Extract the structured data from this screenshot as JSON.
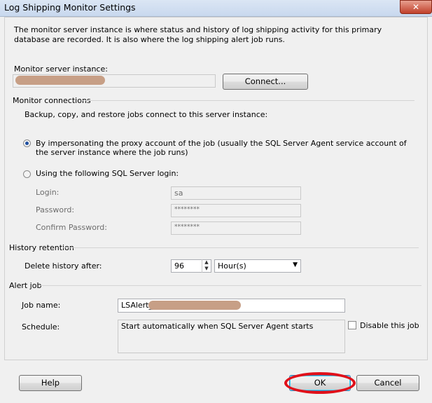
{
  "window": {
    "title": "Log Shipping Monitor Settings",
    "close_label": "✕"
  },
  "description": "The monitor server instance is where status and history of log shipping activity for this primary database are recorded. It is also where the log shipping alert job runs.",
  "monitor_server": {
    "label": "Monitor server instance:",
    "value": "",
    "connect_label": "Connect..."
  },
  "connections": {
    "header": "Monitor connections",
    "intro": "Backup, copy, and restore jobs connect to this server instance:",
    "option_impersonate": "By impersonating the proxy account of the job (usually the SQL Server Agent service account of the server instance where the job runs)",
    "option_impersonate_selected": true,
    "option_sql_login": "Using the following SQL Server login:",
    "login_label": "Login:",
    "login_value": "sa",
    "password_label": "Password:",
    "password_value": "********",
    "confirm_label": "Confirm Password:",
    "confirm_value": "********"
  },
  "history": {
    "header": "History retention",
    "delete_label": "Delete history after:",
    "value": "96",
    "unit": "Hour(s)"
  },
  "alert": {
    "header": "Alert job",
    "job_name_label": "Job name:",
    "job_name_value": "LSAlert_",
    "schedule_label": "Schedule:",
    "schedule_value": "Start automatically when SQL Server Agent starts",
    "disable_label": "Disable this job"
  },
  "buttons": {
    "help": "Help",
    "ok": "OK",
    "cancel": "Cancel"
  },
  "colors": {
    "highlight_ring": "#e0101a",
    "redaction": "#c49a80"
  }
}
